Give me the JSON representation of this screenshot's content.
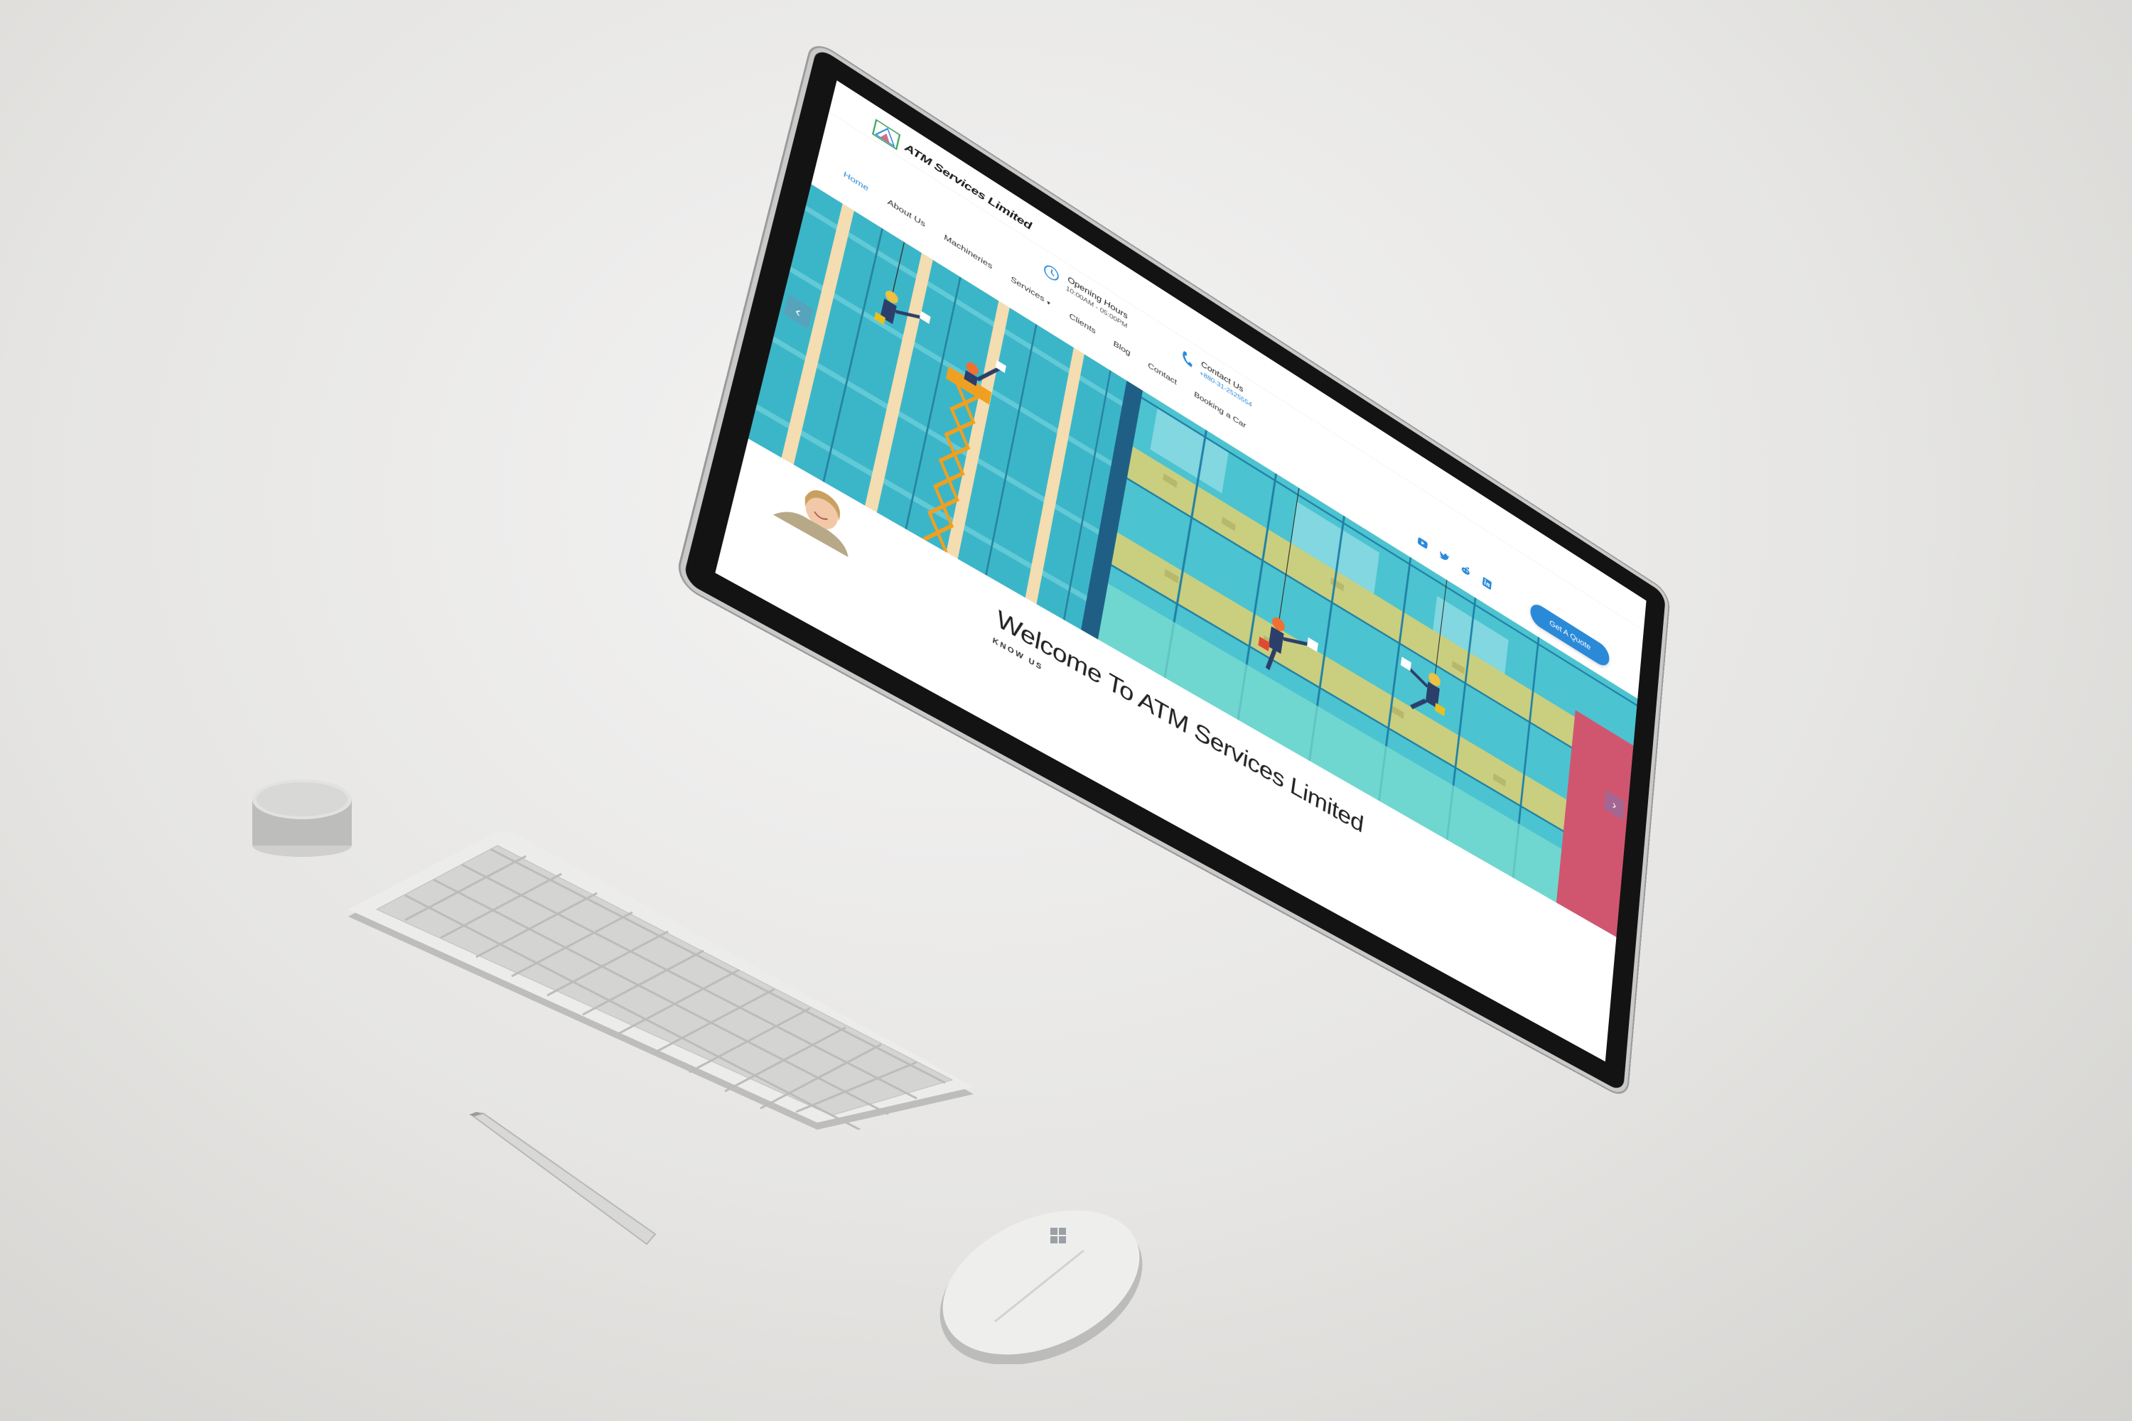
{
  "header": {
    "company_name": "ATM Services Limited",
    "hours_label": "Opening Hours",
    "hours_value": "10:00AM - 05:00PM",
    "contact_label": "Contact Us",
    "contact_value": "+880-31-2525554",
    "quote_button": "Get A Quote"
  },
  "nav": {
    "items": [
      {
        "label": "Home"
      },
      {
        "label": "About Us"
      },
      {
        "label": "Machineries"
      },
      {
        "label": "Services"
      },
      {
        "label": "Clients"
      },
      {
        "label": "Blog"
      },
      {
        "label": "Contact"
      },
      {
        "label": "Booking a Car"
      }
    ]
  },
  "social": {
    "icons": [
      "youtube-icon",
      "twitter-icon",
      "reddit-icon",
      "linkedin-icon"
    ]
  },
  "hero": {
    "prev_arrow": "‹",
    "next_arrow": "›"
  },
  "welcome": {
    "title": "Welcome To ATM Services Limited",
    "subtitle": "KNOW US"
  },
  "colors": {
    "accent": "#2a8ad8",
    "hero_glass": "#3bb6c8",
    "hero_wall": "#c9cf7e",
    "hero_pink": "#d05670"
  }
}
